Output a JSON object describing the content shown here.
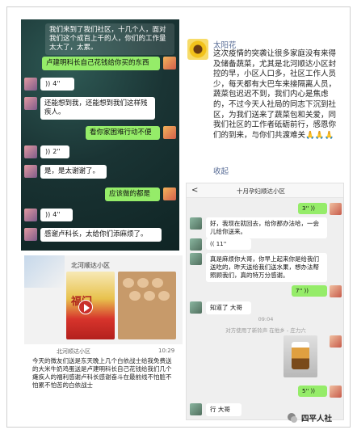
{
  "panel1": {
    "msg1": "我们来到了我们社区，十几个人，面对我们这个成百上千的人，你们的工作量太大了，太累。",
    "msg2": "卢建明科长自己花钱给你买的东西",
    "voice1": "4''",
    "msg3": "还能想到我，还能想到我们这样残疾人。",
    "msg4": "看你家困难行动不便",
    "voice2": "2''",
    "msg5": "是，是太谢谢了。",
    "msg6": "应该做的都是",
    "voice3": "4''",
    "msg7": "感谢卢科长，太给你们添麻烦了。"
  },
  "panel2": {
    "name": "太阳花",
    "body": "这次疫情的突袭让很多家庭没有来得及储备蔬菜，尤其是北河顺达小区封控的早，小区人口多，社区工作人员少，每天都有大巴车来接隔离人员，蔬菜包迟迟不到，我们内心是焦虑的，不过今天人社局的同志下沉到社区，为我们送来了蔬菜包和关爱，同我们社区的工作者砥砺前行，感恩你们的到来，与你们共渡难关🙏🙏🙏",
    "collapse": "收起"
  },
  "panel3": {
    "title": "北河顺达小区",
    "rice_label": "福门",
    "header": "北河顺达小区",
    "time": "10:29",
    "text": "今天的微友们送是东天晚上几个白依战士给我免费送的大米牛奶鸡蛋送是卢建明科长自己花钱给我们几个瘫疾人的福利感谢卢科长感谢奋斗在最前线不怕脏不怕累不怕苦的白依战士"
  },
  "panel4": {
    "back": "<",
    "title": "十月孕妇顺达小区",
    "voice_r1": "3''",
    "msg_l1": "好，我现在就回去，给你那办法哈，一会儿给你送来。",
    "voice_l1": "11''",
    "msg_l2": "真是麻烦你大哥，你早上起来你是给我们送吃的，昨天送给我们送水果，想办法帮照顾我们，真的特万分感谢。",
    "voice_r2": "7''",
    "msg_l3": "知道了 大哥",
    "sys_time": "09:04",
    "sys_note": "对方使用了新铃声 在他乡 - 庄力六",
    "voice_r3": "5''",
    "msg_l4": "行 大哥"
  },
  "watermark": {
    "text": "四平人社"
  }
}
